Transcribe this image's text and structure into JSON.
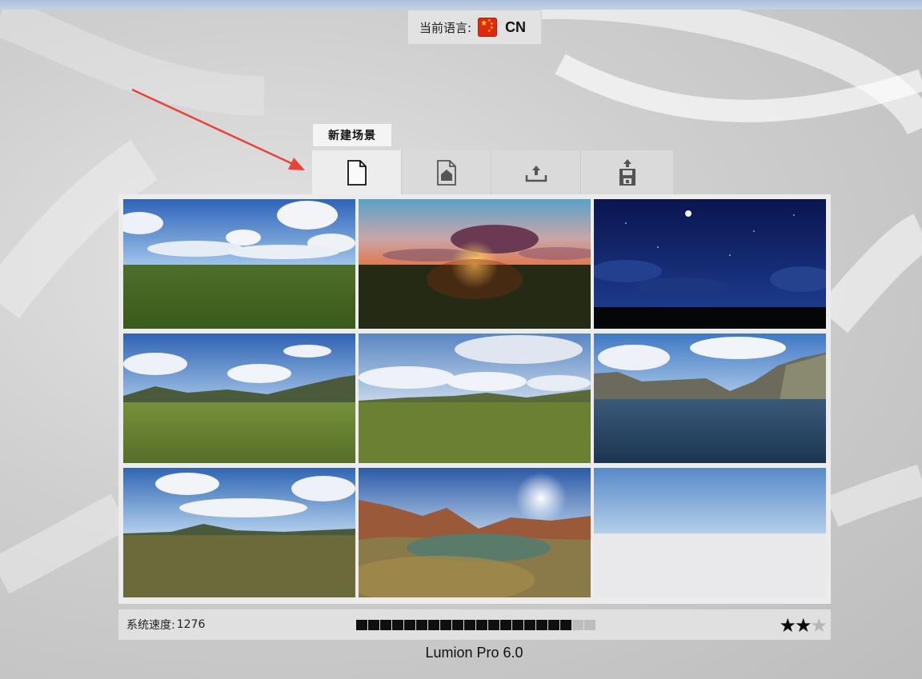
{
  "language": {
    "label": "当前语言:",
    "code": "CN",
    "flag_icon": "china-flag-icon"
  },
  "tooltip": "新建场景",
  "toolbar": [
    {
      "id": "new-scene",
      "icon": "new-file-icon",
      "active": true
    },
    {
      "id": "examples",
      "icon": "house-file-icon",
      "active": false
    },
    {
      "id": "load",
      "icon": "load-upload-icon",
      "active": false
    },
    {
      "id": "save",
      "icon": "save-disk-icon",
      "active": false
    }
  ],
  "scenes": [
    {
      "name": "sunny-day"
    },
    {
      "name": "sunset"
    },
    {
      "name": "night"
    },
    {
      "name": "hills-day"
    },
    {
      "name": "cloudy-plain"
    },
    {
      "name": "mountain-lake"
    },
    {
      "name": "coast-plain"
    },
    {
      "name": "desert-canyon"
    },
    {
      "name": "empty-sky"
    }
  ],
  "status": {
    "speed_label": "系统速度:",
    "speed_value": "1276",
    "bar_segments_total": 20,
    "bar_segments_filled": 18,
    "rating_max": 3,
    "rating": 2
  },
  "version": "Lumion Pro 6.0",
  "colors": {
    "accent_arrow": "#e8433a",
    "bar_on": "#0f0f0f",
    "bar_off": "#bdbdbd"
  }
}
